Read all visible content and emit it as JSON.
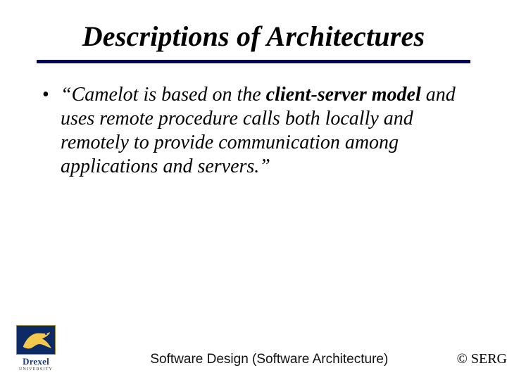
{
  "title": "Descriptions of Architectures",
  "bullet": {
    "open_quote": "“",
    "pre": "Camelot is based on the ",
    "emph": "client-server model",
    "post": " and uses remote procedure calls both locally and remotely to provide communication among applications and servers.”"
  },
  "footer": {
    "center": "Software Design (Software Architecture)",
    "right": "© SERG"
  },
  "logo": {
    "name": "Drexel",
    "sub": "UNIVERSITY"
  }
}
